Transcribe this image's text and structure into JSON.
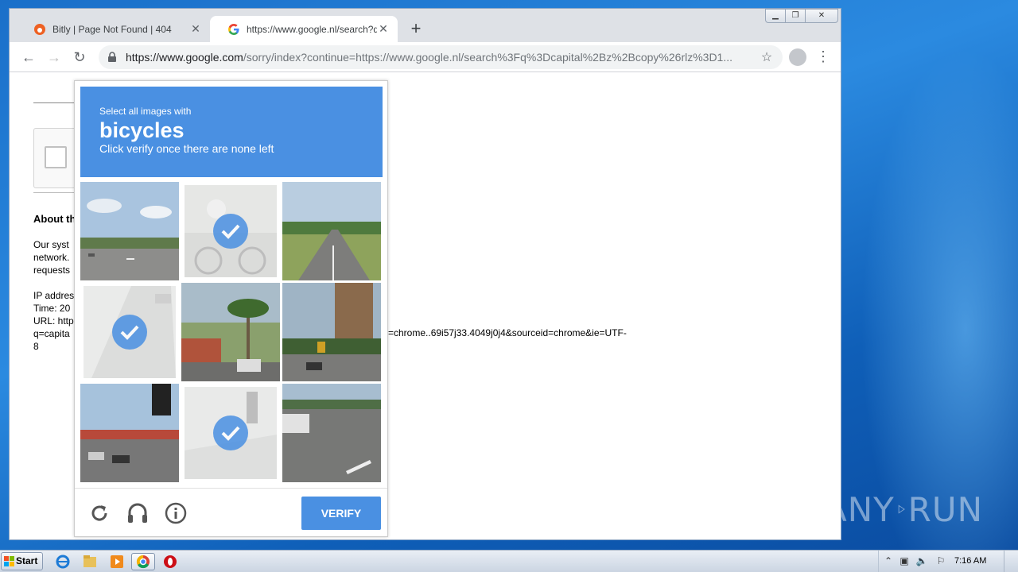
{
  "browser": {
    "tabs": [
      {
        "title": "Bitly | Page Not Found | 404",
        "favicon": "bitly-icon"
      },
      {
        "title": "https://www.google.nl/search?q=ca",
        "favicon": "google-icon"
      }
    ],
    "new_tab_label": "+",
    "address": {
      "host": "https://www.google.com",
      "path": "/sorry/index?continue=https://www.google.nl/search%3Fq%3Dcapital%2Bz%2Bcopy%26rlz%3D1..."
    }
  },
  "page": {
    "about_heading": "About th",
    "para1": "Our syst\nnetwork.\nrequests",
    "para2": "IP addres\nTime: 20\nURL: http\nq=capita\n8",
    "url_tail": "=chrome..69i57j33.4049j0j4&sourceid=chrome&ie=UTF-"
  },
  "captcha": {
    "instruction": "Select all images with",
    "target": "bicycles",
    "hint": "Click verify once there are none left",
    "verify_label": "VERIFY",
    "selected_tiles": [
      2,
      4,
      8
    ],
    "accent": "#4a90e2"
  },
  "taskbar": {
    "start_label": "Start",
    "clock": "7:16 AM"
  },
  "watermark": {
    "left": "ANY",
    "right": "RUN"
  }
}
